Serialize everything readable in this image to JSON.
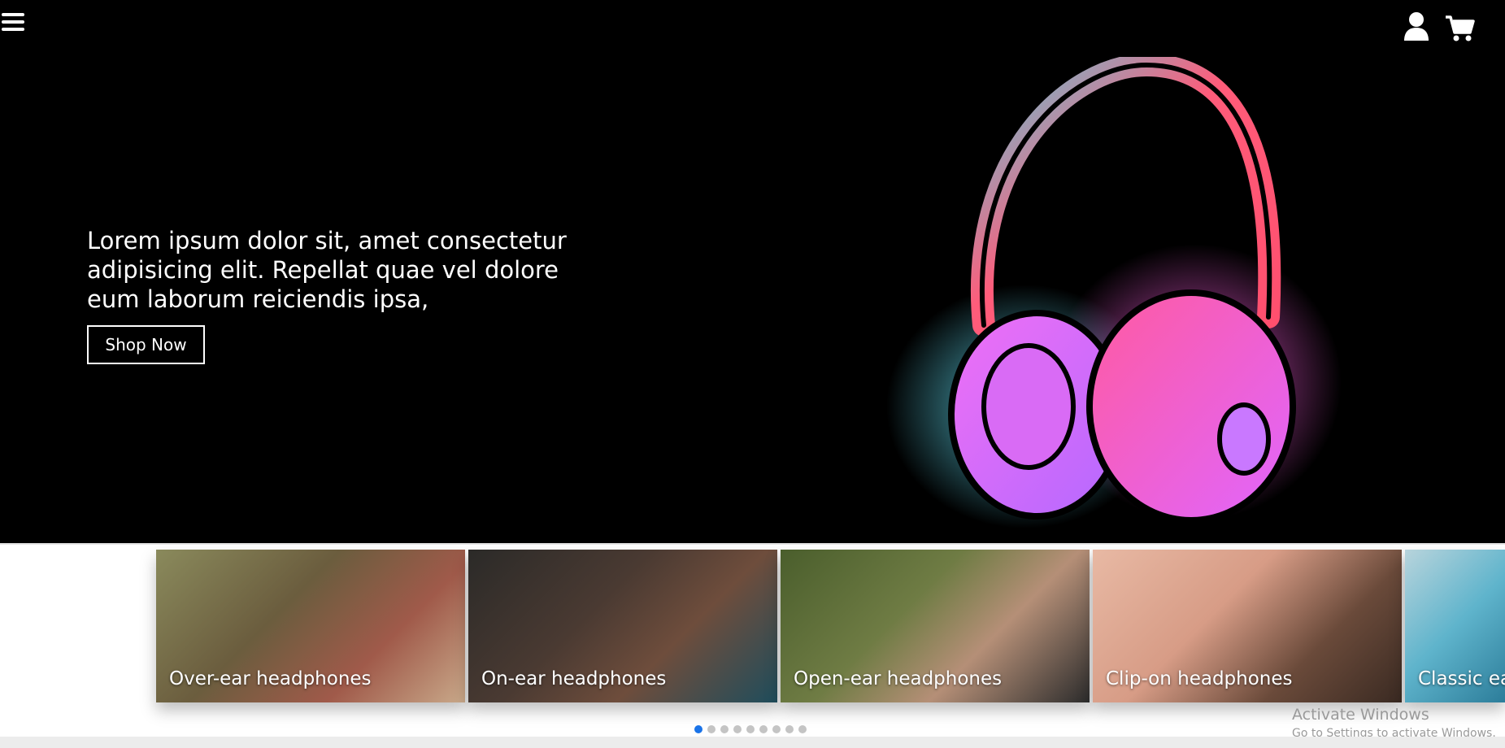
{
  "hero": {
    "headline": "Lorem ipsum dolor sit, amet consectetur adipisicing elit. Repellat quae vel dolore eum laborum reiciendis ipsa,",
    "cta_label": "Shop Now",
    "background_color": "#000000",
    "icons": {
      "menu": "hamburger-icon",
      "user": "user-icon",
      "cart": "cart-icon"
    }
  },
  "categories": [
    {
      "label": "Over-ear headphones"
    },
    {
      "label": "On-ear headphones"
    },
    {
      "label": "Open-ear headphones"
    },
    {
      "label": "Clip-on headphones"
    },
    {
      "label": "Classic ea"
    }
  ],
  "carousel": {
    "dot_count": 9,
    "active_index": 0,
    "active_color": "#1a73e8"
  },
  "watermark": {
    "title": "Activate Windows",
    "subtitle": "Go to Settings to activate Windows."
  }
}
